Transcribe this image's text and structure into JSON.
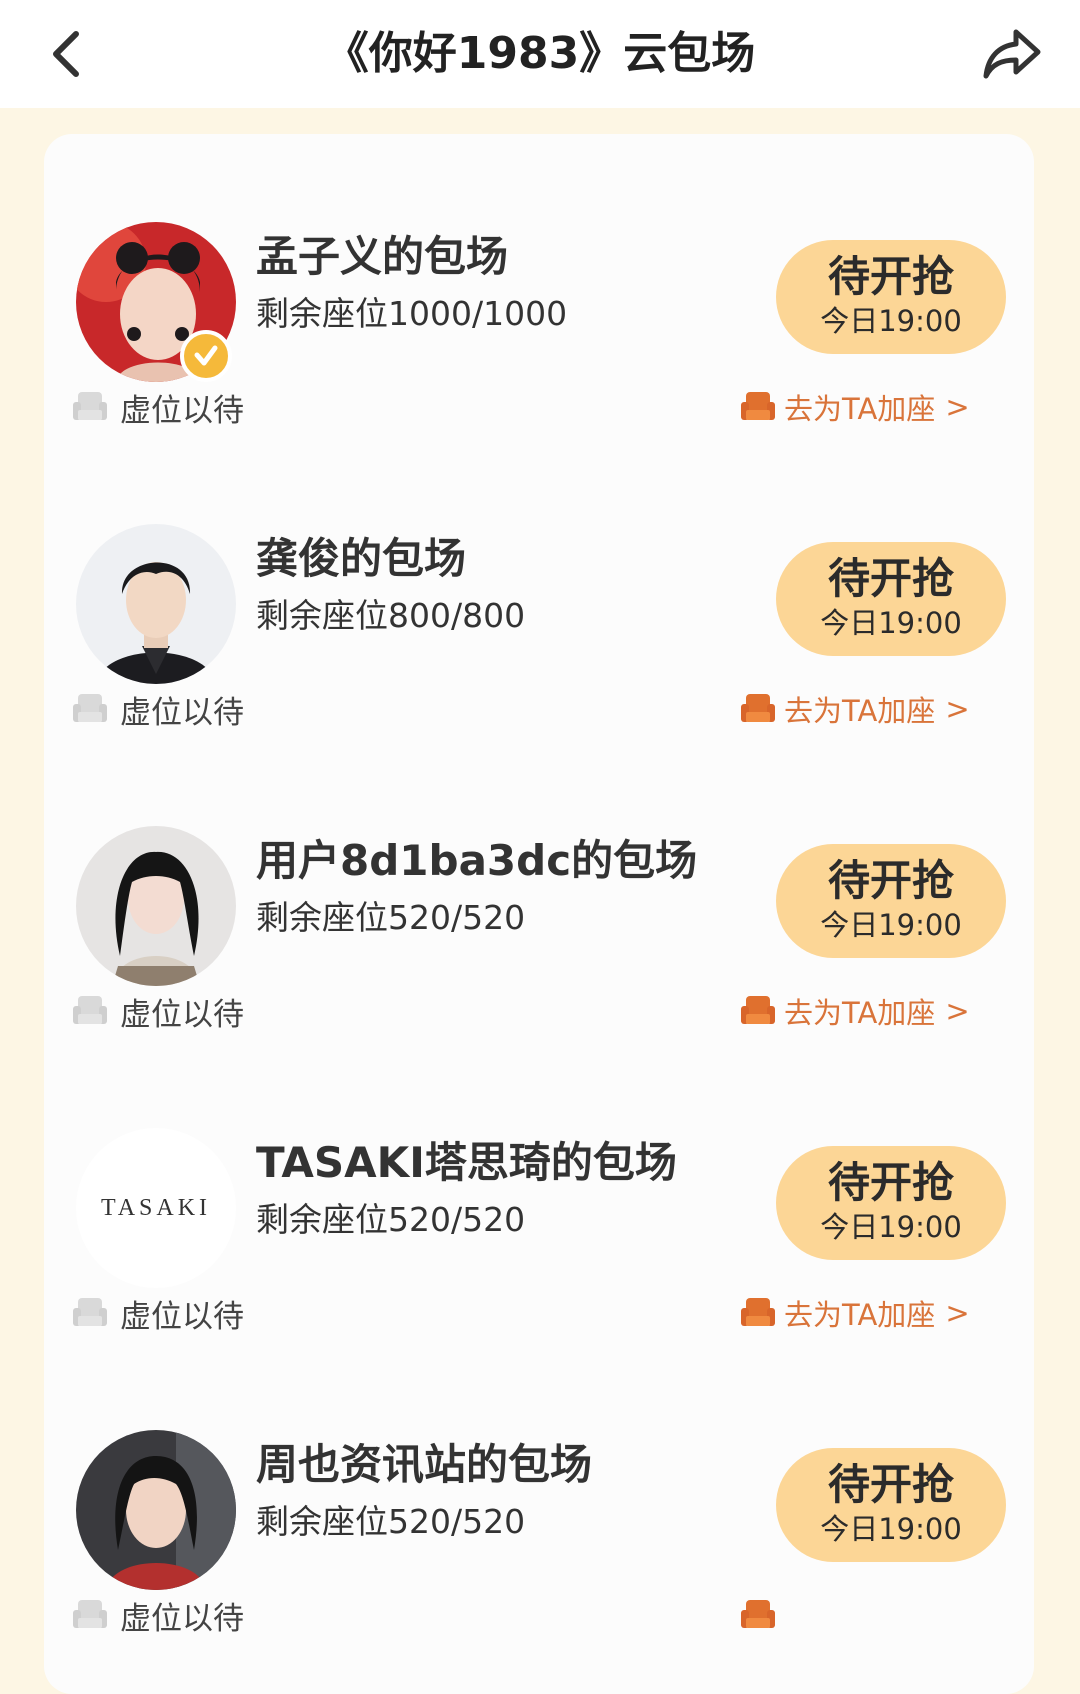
{
  "header": {
    "title": "《你好1983》云包场"
  },
  "icons": {
    "back": "chevron-left-icon",
    "share": "share-arrow-icon",
    "seat_empty": "empty-seat-icon",
    "seat_add": "sofa-seat-icon",
    "verified": "verified-badge-icon"
  },
  "colors": {
    "background": "#fdf6e4",
    "grab_button": "#fcd696",
    "add_seat_accent": "#d9743a"
  },
  "rows": [
    {
      "name": "孟子义的包场",
      "seats": "剩余座位1000/1000",
      "button_main": "待开抢",
      "button_time": "今日19:00",
      "waiting": "虚位以待",
      "add_seat": "去为TA加座",
      "add_chevron": ">",
      "verified": true
    },
    {
      "name": "龚俊的包场",
      "seats": "剩余座位800/800",
      "button_main": "待开抢",
      "button_time": "今日19:00",
      "waiting": "虚位以待",
      "add_seat": "去为TA加座",
      "add_chevron": ">"
    },
    {
      "name": "用户8d1ba3dc的包场",
      "seats": "剩余座位520/520",
      "button_main": "待开抢",
      "button_time": "今日19:00",
      "waiting": "虚位以待",
      "add_seat": "去为TA加座",
      "add_chevron": ">"
    },
    {
      "name": "TASAKI塔思琦的包场",
      "seats": "剩余座位520/520",
      "button_main": "待开抢",
      "button_time": "今日19:00",
      "waiting": "虚位以待",
      "add_seat": "去为TA加座",
      "add_chevron": ">",
      "logo_text": "TASAKI"
    },
    {
      "name": "周也资讯站的包场",
      "seats": "剩余座位520/520",
      "button_main": "待开抢",
      "button_time": "今日19:00",
      "waiting": "虚位以待"
    }
  ]
}
